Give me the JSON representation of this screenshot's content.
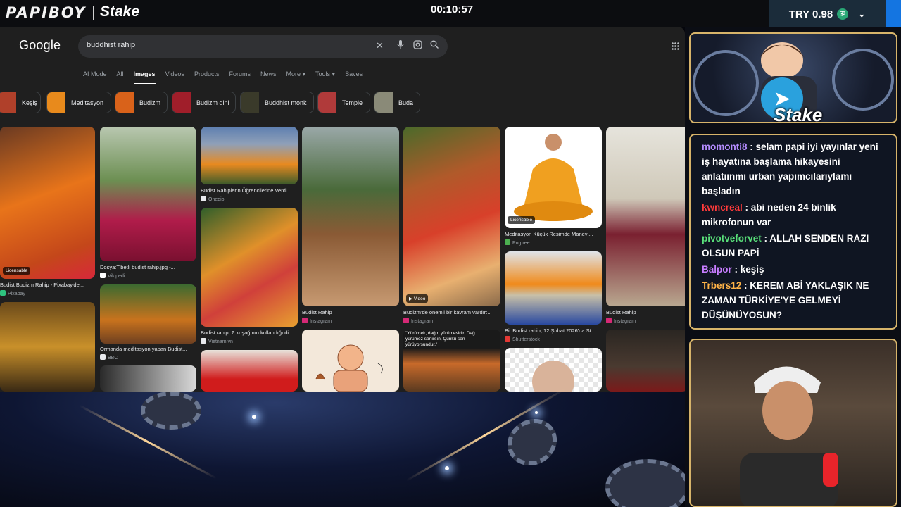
{
  "stream": {
    "channel_logo": "PAPIBOY",
    "sponsor_logo": "Stake",
    "timer": "00:10:57",
    "balance": "TRY 0.98",
    "currency_icon": "tether-icon"
  },
  "google": {
    "logo": "Google",
    "query": "buddhist rahip",
    "tabs": [
      "AI Mode",
      "All",
      "Images",
      "Videos",
      "Products",
      "Forums",
      "News",
      "More ▾",
      "Tools ▾",
      "Saves"
    ],
    "active_tab": "Images",
    "chips": [
      "Keşiş",
      "Meditasyon",
      "Budizm",
      "Budizm dini",
      "Buddhist monk",
      "Temple",
      "Buda"
    ],
    "results": [
      {
        "caption": "Budist Budizm Rahip - Pixabay'de...",
        "source": "Pixabay",
        "badge": "Licensable",
        "color": "#ff6a00"
      },
      {
        "caption": "Dosya:Tibetli budist rahip.jpg -...",
        "source": "Vikipedi",
        "badge": "",
        "color": "#b0203a"
      },
      {
        "caption": "Budist Rahiplerin Öğrencilerine Verdi...",
        "source": "Onedio",
        "badge": "",
        "color": "#e98a1f"
      },
      {
        "caption": "Ormanda meditasyon yapan Budist...",
        "source": "BBC",
        "badge": "",
        "color": "#c9731d"
      },
      {
        "caption": "Budist rahip, Z kuşağının kullandığı di...",
        "source": "Vietnam.vn",
        "badge": "",
        "color": "#dd8a20"
      },
      {
        "caption": "Budist Rahip",
        "source": "Instagram",
        "badge": "",
        "color": "#8a5a35"
      },
      {
        "caption": "Budizm'de önemli bir kavram vardır:...",
        "source": "Instagram",
        "badge": "Video",
        "color": "#d33a1f"
      },
      {
        "caption": "Meditasyon Küçük Resimde Manevi...",
        "source": "Pngtree",
        "badge": "Licensable",
        "color": "#f0a020"
      },
      {
        "caption": "Bir Budist rahip, 12 Şubat 2026'da St...",
        "source": "Shutterstock",
        "badge": "",
        "color": "#f28a1a"
      },
      {
        "caption": "Budist Rahip",
        "source": "Instagram",
        "badge": "",
        "color": "#7a2030"
      }
    ],
    "quote_text": "\"Yürümek, dağın yürümesidir. Dağ yürümez sanırsın, Çünkü sen yürüyorsundur.\""
  },
  "chat": {
    "messages": [
      {
        "user": "momonti8",
        "color": "#b48cff",
        "text": "selam papi iyi yayınlar yeni iş hayatına başlama hikayesini anlatıınmı urban yapımcılarıylamı başladın"
      },
      {
        "user": "kwncreal",
        "color": "#ff3b3b",
        "text": "abi neden 24 binlik mikrofonun var"
      },
      {
        "user": "pivotveforvet",
        "color": "#59e07a",
        "text": "ALLAH SENDEN RAZI OLSUN PAPİ"
      },
      {
        "user": "Balpor",
        "color": "#c77dff",
        "text": "keşiş"
      },
      {
        "user": "Trbers12",
        "color": "#ffb347",
        "text": "KEREM ABİ YAKLAŞIK NE ZAMAN TÜRKİYE'YE GELMEYİ DÜŞÜNÜYOSUN?"
      }
    ]
  },
  "promo": {
    "brand": "Stake",
    "icon": "telegram-icon"
  }
}
